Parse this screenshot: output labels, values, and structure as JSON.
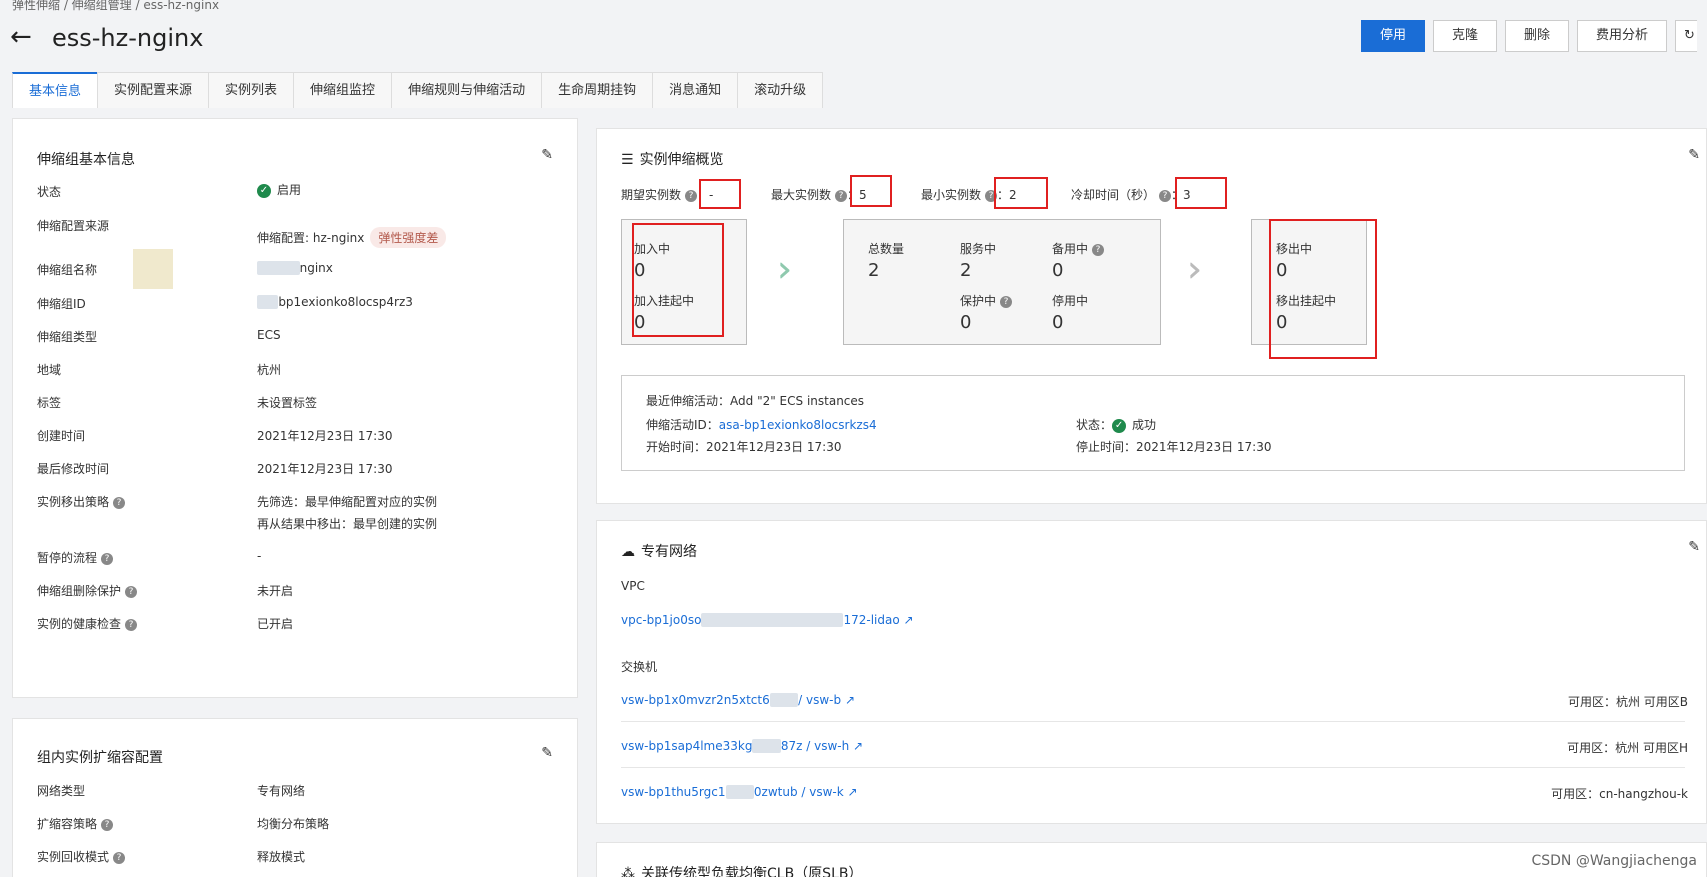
{
  "breadcrumb": "弹性伸缩 / 伸缩组管理 / ess-hz-nginx",
  "page_title": "ess-hz-nginx",
  "toolbar": {
    "disable": "停用",
    "clone": "克隆",
    "delete": "删除",
    "cost": "费用分析"
  },
  "tabs": [
    "基本信息",
    "实例配置来源",
    "实例列表",
    "伸缩组监控",
    "伸缩规则与伸缩活动",
    "生命周期挂钩",
    "消息通知",
    "滚动升级"
  ],
  "basic": {
    "title": "伸缩组基本信息",
    "rows": [
      {
        "label": "状态",
        "value": "启用"
      },
      {
        "label": "伸缩配置来源",
        "value": "伸缩配置: hz-nginx",
        "badge": "弹性强度差"
      },
      {
        "label": "伸缩组名称",
        "value": "nginx"
      },
      {
        "label": "伸缩组ID",
        "value": "bp1exionko8locsp4rz3"
      },
      {
        "label": "伸缩组类型",
        "value": "ECS"
      },
      {
        "label": "地域",
        "value": "杭州"
      },
      {
        "label": "标签",
        "value": "未设置标签"
      },
      {
        "label": "创建时间",
        "value": "2021年12月23日 17:30"
      },
      {
        "label": "最后修改时间",
        "value": "2021年12月23日 17:30"
      },
      {
        "label": "实例移出策略",
        "value": "先筛选：最早伸缩配置对应的实例",
        "value2": "再从结果中移出：最早创建的实例"
      },
      {
        "label": "暂停的流程",
        "value": "-"
      },
      {
        "label": "伸缩组删除保护",
        "value": "未开启"
      },
      {
        "label": "实例的健康检查",
        "value": "已开启"
      }
    ]
  },
  "scaling": {
    "title": "组内实例扩缩容配置",
    "rows": [
      {
        "label": "网络类型",
        "value": "专有网络"
      },
      {
        "label": "扩缩容策略",
        "value": "均衡分布策略"
      },
      {
        "label": "实例回收模式",
        "value": "释放模式"
      }
    ]
  },
  "overview": {
    "title": "实例伸缩概览",
    "desired_label": "期望实例数",
    "desired": "-",
    "max_label": "最大实例数",
    "max": "5",
    "min_label": "最小实例数",
    "min": "2",
    "cooldown_label": "冷却时间（秒）",
    "cooldown": "3",
    "joining_label": "加入中",
    "joining": "0",
    "join_pending_label": "加入挂起中",
    "join_pending": "0",
    "total_label": "总数量",
    "total": "2",
    "inservice_label": "服务中",
    "inservice": "2",
    "standby_label": "备用中",
    "standby": "0",
    "protected_label": "保护中",
    "protected": "0",
    "stopped_label": "停用中",
    "stopped": "0",
    "removing_label": "移出中",
    "removing": "0",
    "remove_pending_label": "移出挂起中",
    "remove_pending": "0",
    "activity_label": "最近伸缩活动：",
    "activity": "Add \"2\" ECS instances",
    "activity_id_label": "伸缩活动ID：",
    "activity_id": "asa-bp1exionko8locsrkzs4",
    "status_label": "状态：",
    "status": "成功",
    "start_label": "开始时间：",
    "start": "2021年12月23日 17:30",
    "stop_label": "停止时间：",
    "stop": "2021年12月23日 17:30"
  },
  "vpc": {
    "title": "专有网络",
    "vpc_label": "VPC",
    "vpc_id_a": "vpc-bp1jo0so",
    "vpc_id_b": "172-lidao",
    "switch_label": "交换机",
    "switches": [
      {
        "a": "vsw-bp1x0mvzr2n5xtct6",
        "b": "/ vsw-b",
        "zone": "可用区：杭州 可用区B"
      },
      {
        "a": "vsw-bp1sap4lme33kg",
        "b": "87z / vsw-h",
        "zone": "可用区：杭州 可用区H"
      },
      {
        "a": "vsw-bp1thu5rgc1",
        "b": "0zwtub / vsw-k",
        "zone": "可用区：cn-hangzhou-k"
      }
    ]
  },
  "clb": {
    "title": "关联传统型负载均衡CLB（原SLB）"
  },
  "watermark": "CSDN @Wangjiachenga"
}
